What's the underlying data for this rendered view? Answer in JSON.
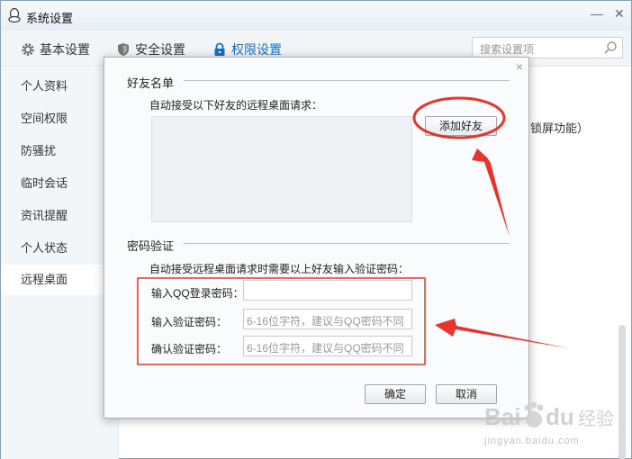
{
  "window": {
    "title": "系统设置",
    "minimize_icon": "minimize-icon",
    "close_icon": "close-icon"
  },
  "nav": {
    "items": [
      {
        "label": "基本设置",
        "icon": "gear-icon"
      },
      {
        "label": "安全设置",
        "icon": "shield-icon"
      },
      {
        "label": "权限设置",
        "icon": "lock-icon"
      }
    ],
    "active_color": "#1a6fc0",
    "search_placeholder": "搜索设置项"
  },
  "sidebar": {
    "items": [
      {
        "label": "个人资料"
      },
      {
        "label": "空间权限"
      },
      {
        "label": "防骚扰"
      },
      {
        "label": "临时会话"
      },
      {
        "label": "资讯提醒"
      },
      {
        "label": "个人状态"
      },
      {
        "label": "远程桌面"
      }
    ],
    "active_item": "远程桌面"
  },
  "background": {
    "partial_text": "锁屏功能）"
  },
  "dialog": {
    "friends_section": {
      "title": "好友名单",
      "description": "自动接受以下好友的远程桌面请求：",
      "add_button": "添加好友"
    },
    "password_section": {
      "title": "密码验证",
      "description": "自动接受远程桌面请求时需要以上好友输入验证密码：",
      "fields": [
        {
          "label": "输入QQ登录密码：",
          "value": "",
          "placeholder": ""
        },
        {
          "label": "输入验证密码：",
          "value": "",
          "placeholder": "6-16位字符，建议与QQ密码不同"
        },
        {
          "label": "确认验证密码：",
          "value": "",
          "placeholder": "6-16位字符，建议与QQ密码不同"
        }
      ]
    },
    "ok_button": "确定",
    "cancel_button": "取消"
  },
  "annotation_color": "#e8352b",
  "watermark": {
    "text": "Bai du 经验",
    "url": "jingyan.baidu.com"
  }
}
